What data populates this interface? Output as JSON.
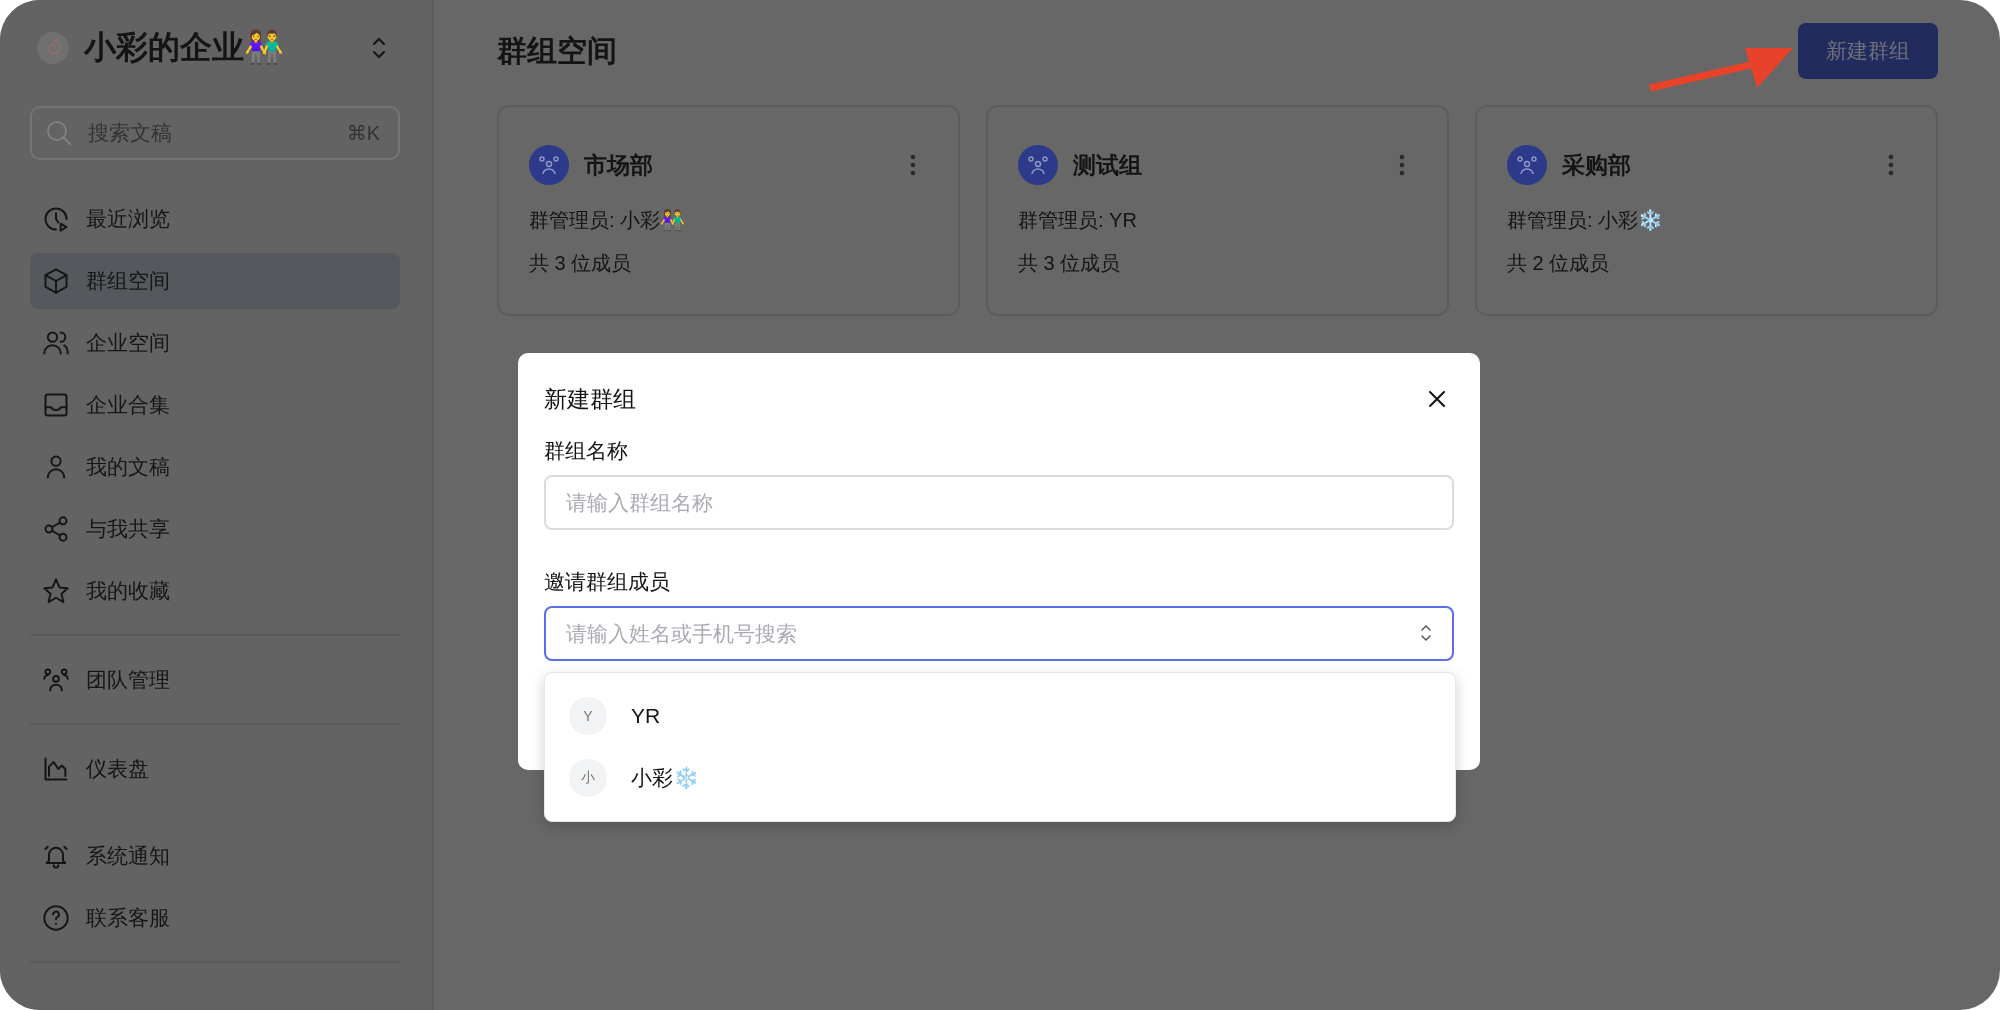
{
  "sidebar": {
    "workspace": {
      "name": "小彩的企业👫"
    },
    "search": {
      "placeholder": "搜索文稿",
      "shortcut": "⌘K"
    },
    "groups": [
      {
        "divider_after": true,
        "items": [
          {
            "label": "最近浏览",
            "selected": false
          },
          {
            "label": "群组空间",
            "selected": true
          },
          {
            "label": "企业空间",
            "selected": false
          },
          {
            "label": "企业合集",
            "selected": false
          },
          {
            "label": "我的文稿",
            "selected": false
          },
          {
            "label": "与我共享",
            "selected": false
          },
          {
            "label": "我的收藏",
            "selected": false
          }
        ]
      },
      {
        "divider_after": true,
        "items": [
          {
            "label": "团队管理",
            "selected": false
          }
        ]
      },
      {
        "divider_after": false,
        "items": [
          {
            "label": "仪表盘",
            "selected": false
          }
        ]
      },
      {
        "divider_after": true,
        "items": [
          {
            "label": "系统通知",
            "selected": false
          },
          {
            "label": "联系客服",
            "selected": false
          }
        ]
      }
    ]
  },
  "page": {
    "title": "群组空间",
    "new_button": "新建群组"
  },
  "cards": [
    {
      "name": "市场部",
      "admin": "群管理员: 小彩👫",
      "members": "共 3 位成员"
    },
    {
      "name": "测试组",
      "admin": "群管理员: YR",
      "members": "共 3 位成员"
    },
    {
      "name": "采购部",
      "admin": "群管理员: 小彩❄️",
      "members": "共 2 位成员"
    }
  ],
  "dialog": {
    "title": "新建群组",
    "fields": [
      {
        "kind": "text",
        "label": "群组名称",
        "placeholder": "请输入群组名称",
        "focused": false
      },
      {
        "kind": "select",
        "label": "邀请群组成员",
        "placeholder": "请输入姓名或手机号搜索",
        "focused": true
      }
    ],
    "options": [
      {
        "initial": "Y",
        "name": "YR"
      },
      {
        "initial": "小",
        "name": "小彩❄️"
      }
    ]
  }
}
